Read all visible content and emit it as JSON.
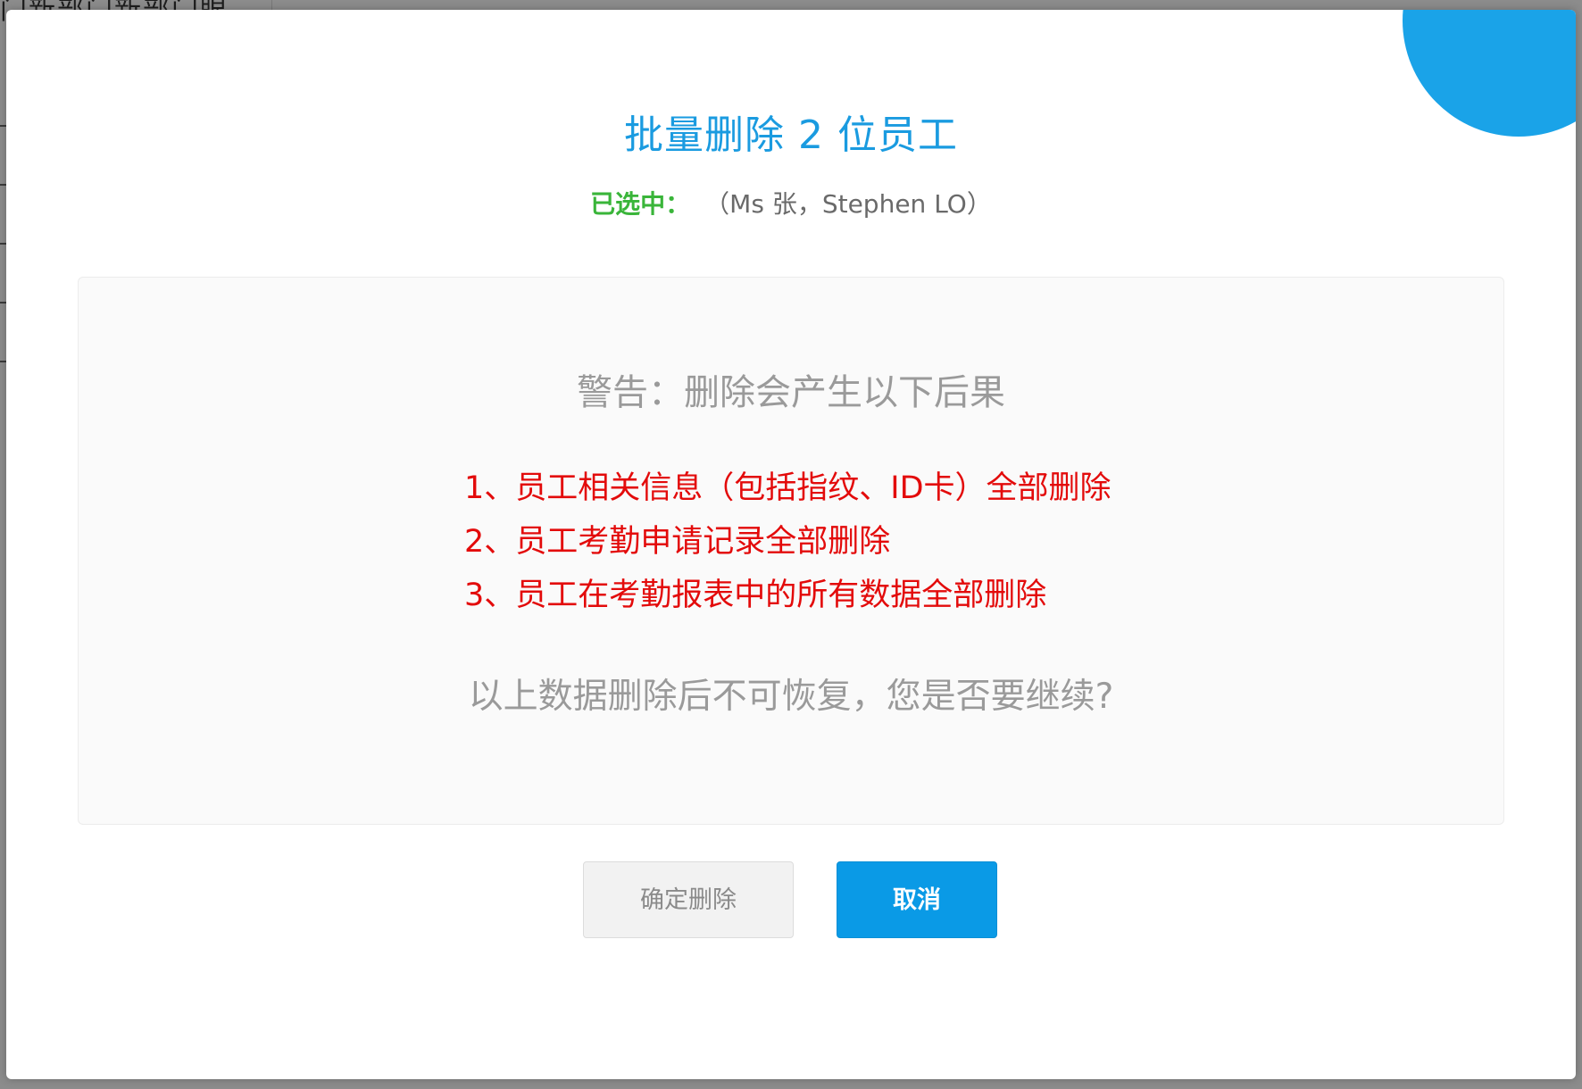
{
  "background": {
    "partial_text": "门新部门新部门眼"
  },
  "dialog": {
    "title": "批量删除 2 位员工",
    "selected_label": "已选中：",
    "selected_names": "（Ms 张，Stephen LO）",
    "close_icon": "close-icon",
    "warning_heading": "警告：删除会产生以下后果",
    "consequences": [
      "1、员工相关信息（包括指纹、ID卡）全部删除",
      "2、员工考勤申请记录全部删除",
      "3、员工在考勤报表中的所有数据全部删除"
    ],
    "question": "以上数据删除后不可恢复，您是否要继续?",
    "confirm_label": "确定删除",
    "cancel_label": "取消"
  },
  "colors": {
    "accent": "#1a9be0",
    "selected_label": "#3ab53a",
    "danger": "#e30b0b",
    "cancel_button": "#0a9ae6"
  }
}
